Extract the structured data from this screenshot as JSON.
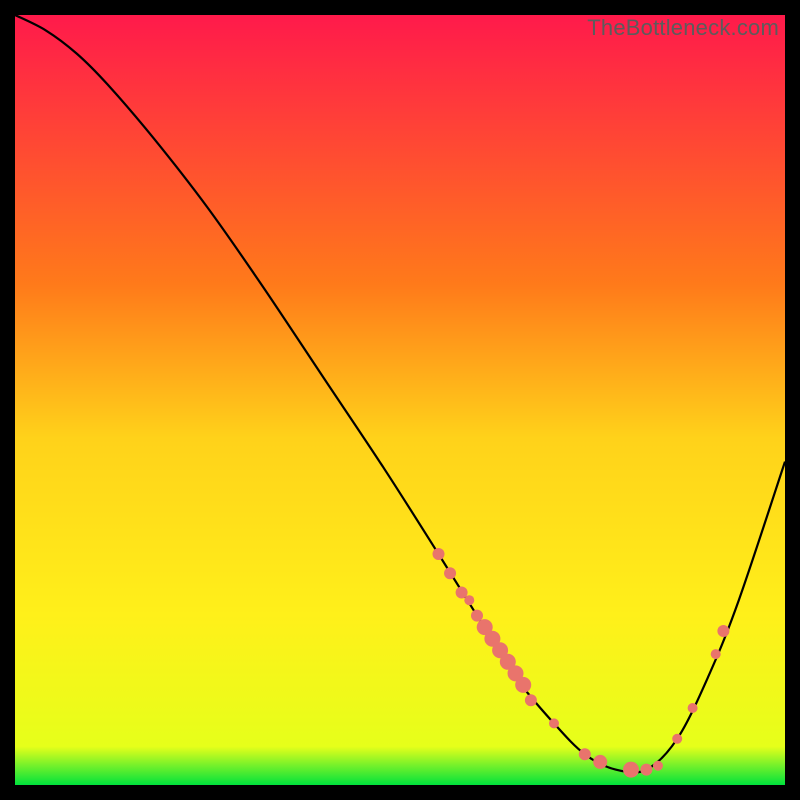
{
  "watermark": "TheBottleneck.com",
  "chart_data": {
    "type": "line",
    "title": "",
    "xlabel": "",
    "ylabel": "",
    "xlim": [
      0,
      100
    ],
    "ylim": [
      0,
      100
    ],
    "gradient_stops": [
      {
        "offset": 0,
        "color": "#ff1a4b"
      },
      {
        "offset": 35,
        "color": "#ff7a1a"
      },
      {
        "offset": 55,
        "color": "#ffd21a"
      },
      {
        "offset": 78,
        "color": "#fff01a"
      },
      {
        "offset": 95,
        "color": "#e6ff1a"
      },
      {
        "offset": 100,
        "color": "#00e23c"
      }
    ],
    "series": [
      {
        "name": "bottleneck-curve",
        "color": "#000000",
        "x": [
          0,
          4,
          8,
          12,
          18,
          25,
          32,
          40,
          48,
          55,
          60,
          65,
          70,
          74,
          78,
          82,
          86,
          90,
          94,
          100
        ],
        "y": [
          100,
          98,
          95,
          91,
          84,
          75,
          65,
          53,
          41,
          30,
          22,
          14,
          8,
          4,
          2,
          2,
          6,
          14,
          24,
          42
        ]
      }
    ],
    "markers": {
      "name": "highlighted-points",
      "color": "#e9746c",
      "points": [
        {
          "x": 55,
          "y": 30,
          "r": 6
        },
        {
          "x": 56.5,
          "y": 27.5,
          "r": 6
        },
        {
          "x": 58,
          "y": 25,
          "r": 6
        },
        {
          "x": 59,
          "y": 24,
          "r": 5
        },
        {
          "x": 60,
          "y": 22,
          "r": 6
        },
        {
          "x": 61,
          "y": 20.5,
          "r": 8
        },
        {
          "x": 62,
          "y": 19,
          "r": 8
        },
        {
          "x": 63,
          "y": 17.5,
          "r": 8
        },
        {
          "x": 64,
          "y": 16,
          "r": 8
        },
        {
          "x": 65,
          "y": 14.5,
          "r": 8
        },
        {
          "x": 66,
          "y": 13,
          "r": 8
        },
        {
          "x": 67,
          "y": 11,
          "r": 6
        },
        {
          "x": 70,
          "y": 8,
          "r": 5
        },
        {
          "x": 74,
          "y": 4,
          "r": 6
        },
        {
          "x": 76,
          "y": 3,
          "r": 7
        },
        {
          "x": 80,
          "y": 2,
          "r": 8
        },
        {
          "x": 82,
          "y": 2,
          "r": 6
        },
        {
          "x": 83.5,
          "y": 2.5,
          "r": 5
        },
        {
          "x": 86,
          "y": 6,
          "r": 5
        },
        {
          "x": 88,
          "y": 10,
          "r": 5
        },
        {
          "x": 91,
          "y": 17,
          "r": 5
        },
        {
          "x": 92,
          "y": 20,
          "r": 6
        }
      ]
    }
  }
}
